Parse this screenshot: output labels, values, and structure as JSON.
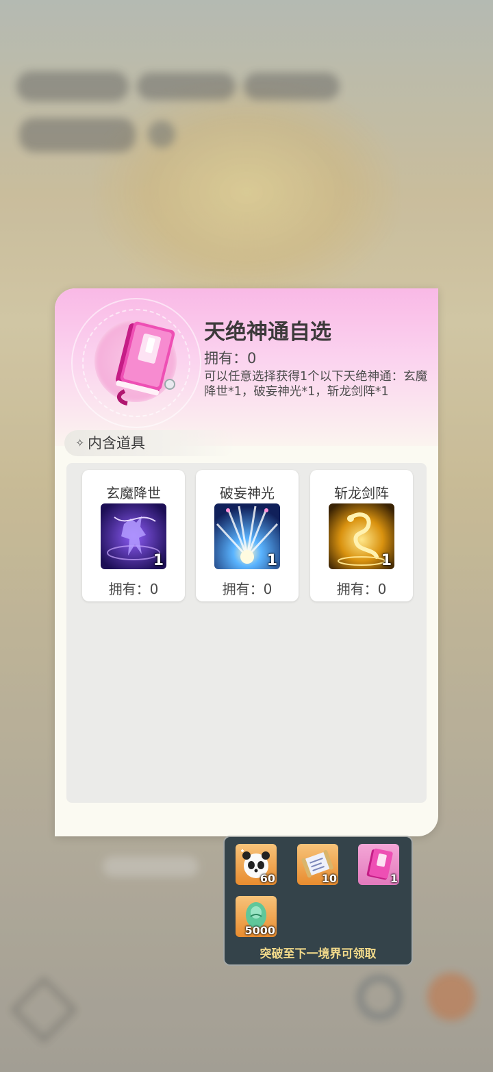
{
  "item": {
    "title": "天绝神通自选",
    "owned_label": "拥有：0",
    "description": "可以任意选择获得1个以下天绝神通：玄魔降世*1，破妄神光*1，斩龙剑阵*1",
    "icon": "pink-book-icon"
  },
  "section": {
    "label": "内含道具"
  },
  "contents": [
    {
      "name": "玄魔降世",
      "count": "1",
      "owned": "拥有：0",
      "icon": "purple-demon-skill-icon"
    },
    {
      "name": "破妄神光",
      "count": "1",
      "owned": "拥有：0",
      "icon": "blue-light-burst-skill-icon"
    },
    {
      "name": "斩龙剑阵",
      "count": "1",
      "owned": "拥有：0",
      "icon": "golden-dragon-skill-icon"
    }
  ],
  "reward_tooltip": {
    "items": [
      {
        "count": "60",
        "icon": "panda-icon"
      },
      {
        "count": "10",
        "icon": "scroll-icon"
      },
      {
        "count": "1",
        "icon": "pink-book-icon"
      },
      {
        "count": "5000",
        "icon": "green-egg-icon"
      }
    ],
    "note": "突破至下一境界可领取"
  },
  "colors": {
    "panel_header": "#f9b9e6",
    "tooltip_bg": "#34434a",
    "tooltip_text": "#f1d98a"
  }
}
